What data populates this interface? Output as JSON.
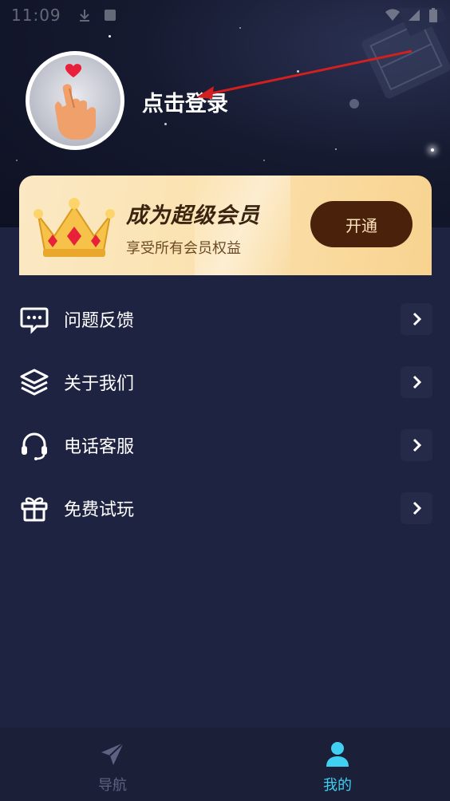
{
  "status_bar": {
    "time": "11:09"
  },
  "profile": {
    "login_label": "点击登录"
  },
  "vip": {
    "title": "成为超级会员",
    "subtitle": "享受所有会员权益",
    "button_label": "开通"
  },
  "menu": {
    "items": [
      {
        "label": "问题反馈",
        "icon": "chat-bubble-icon"
      },
      {
        "label": "关于我们",
        "icon": "layers-icon"
      },
      {
        "label": "电话客服",
        "icon": "headset-icon"
      },
      {
        "label": "免费试玩",
        "icon": "gift-icon"
      }
    ]
  },
  "bottom_nav": {
    "tabs": [
      {
        "label": "导航",
        "icon": "paper-plane-icon",
        "active": false
      },
      {
        "label": "我的",
        "icon": "user-icon",
        "active": true
      }
    ]
  },
  "colors": {
    "background": "#1f2342",
    "header": "#0e1122",
    "vip_card": "#fbe2b0",
    "vip_button": "#4a220c",
    "active_tab": "#3fd0f2",
    "inactive_tab": "#5d6282",
    "annotation_arrow": "#d21f1f"
  }
}
